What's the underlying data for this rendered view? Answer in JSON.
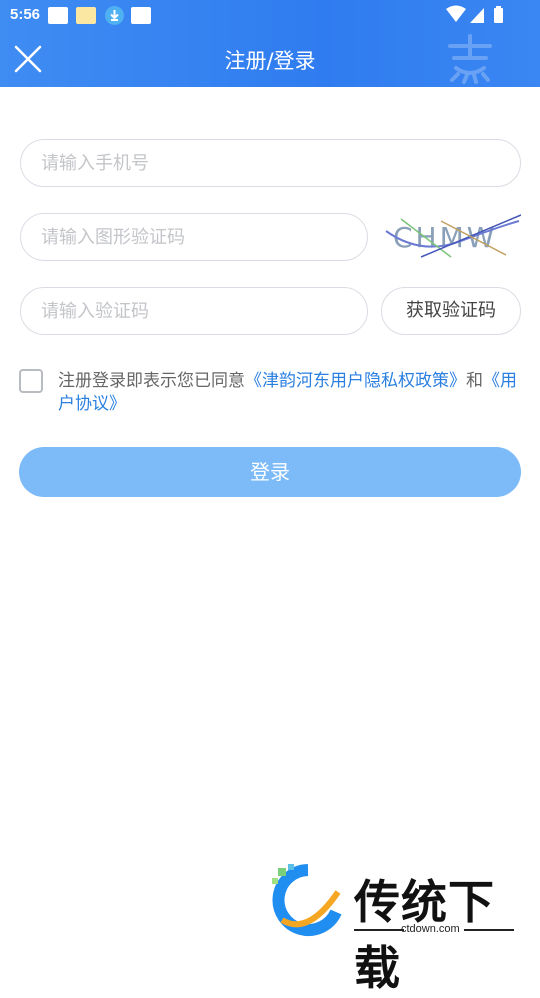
{
  "status_bar": {
    "time": "5:56"
  },
  "header": {
    "title": "注册/登录"
  },
  "form": {
    "phone_placeholder": "请输入手机号",
    "captcha_placeholder": "请输入图形验证码",
    "code_placeholder": "请输入验证码",
    "get_code_label": "获取验证码",
    "captcha_text": "CHMW"
  },
  "agreement": {
    "prefix": "注册登录即表示您已同意",
    "privacy_link": "《津韵河东用户隐私权政策》",
    "conjunction": "和",
    "user_link": "《用户协议》",
    "checked": false
  },
  "login_label": "登录",
  "footer": {
    "brand": "传统下载",
    "url": "ctdown.com"
  },
  "colors": {
    "header": "#2f7cf0",
    "link": "#2a7fe0",
    "button": "#7dbaf8"
  }
}
